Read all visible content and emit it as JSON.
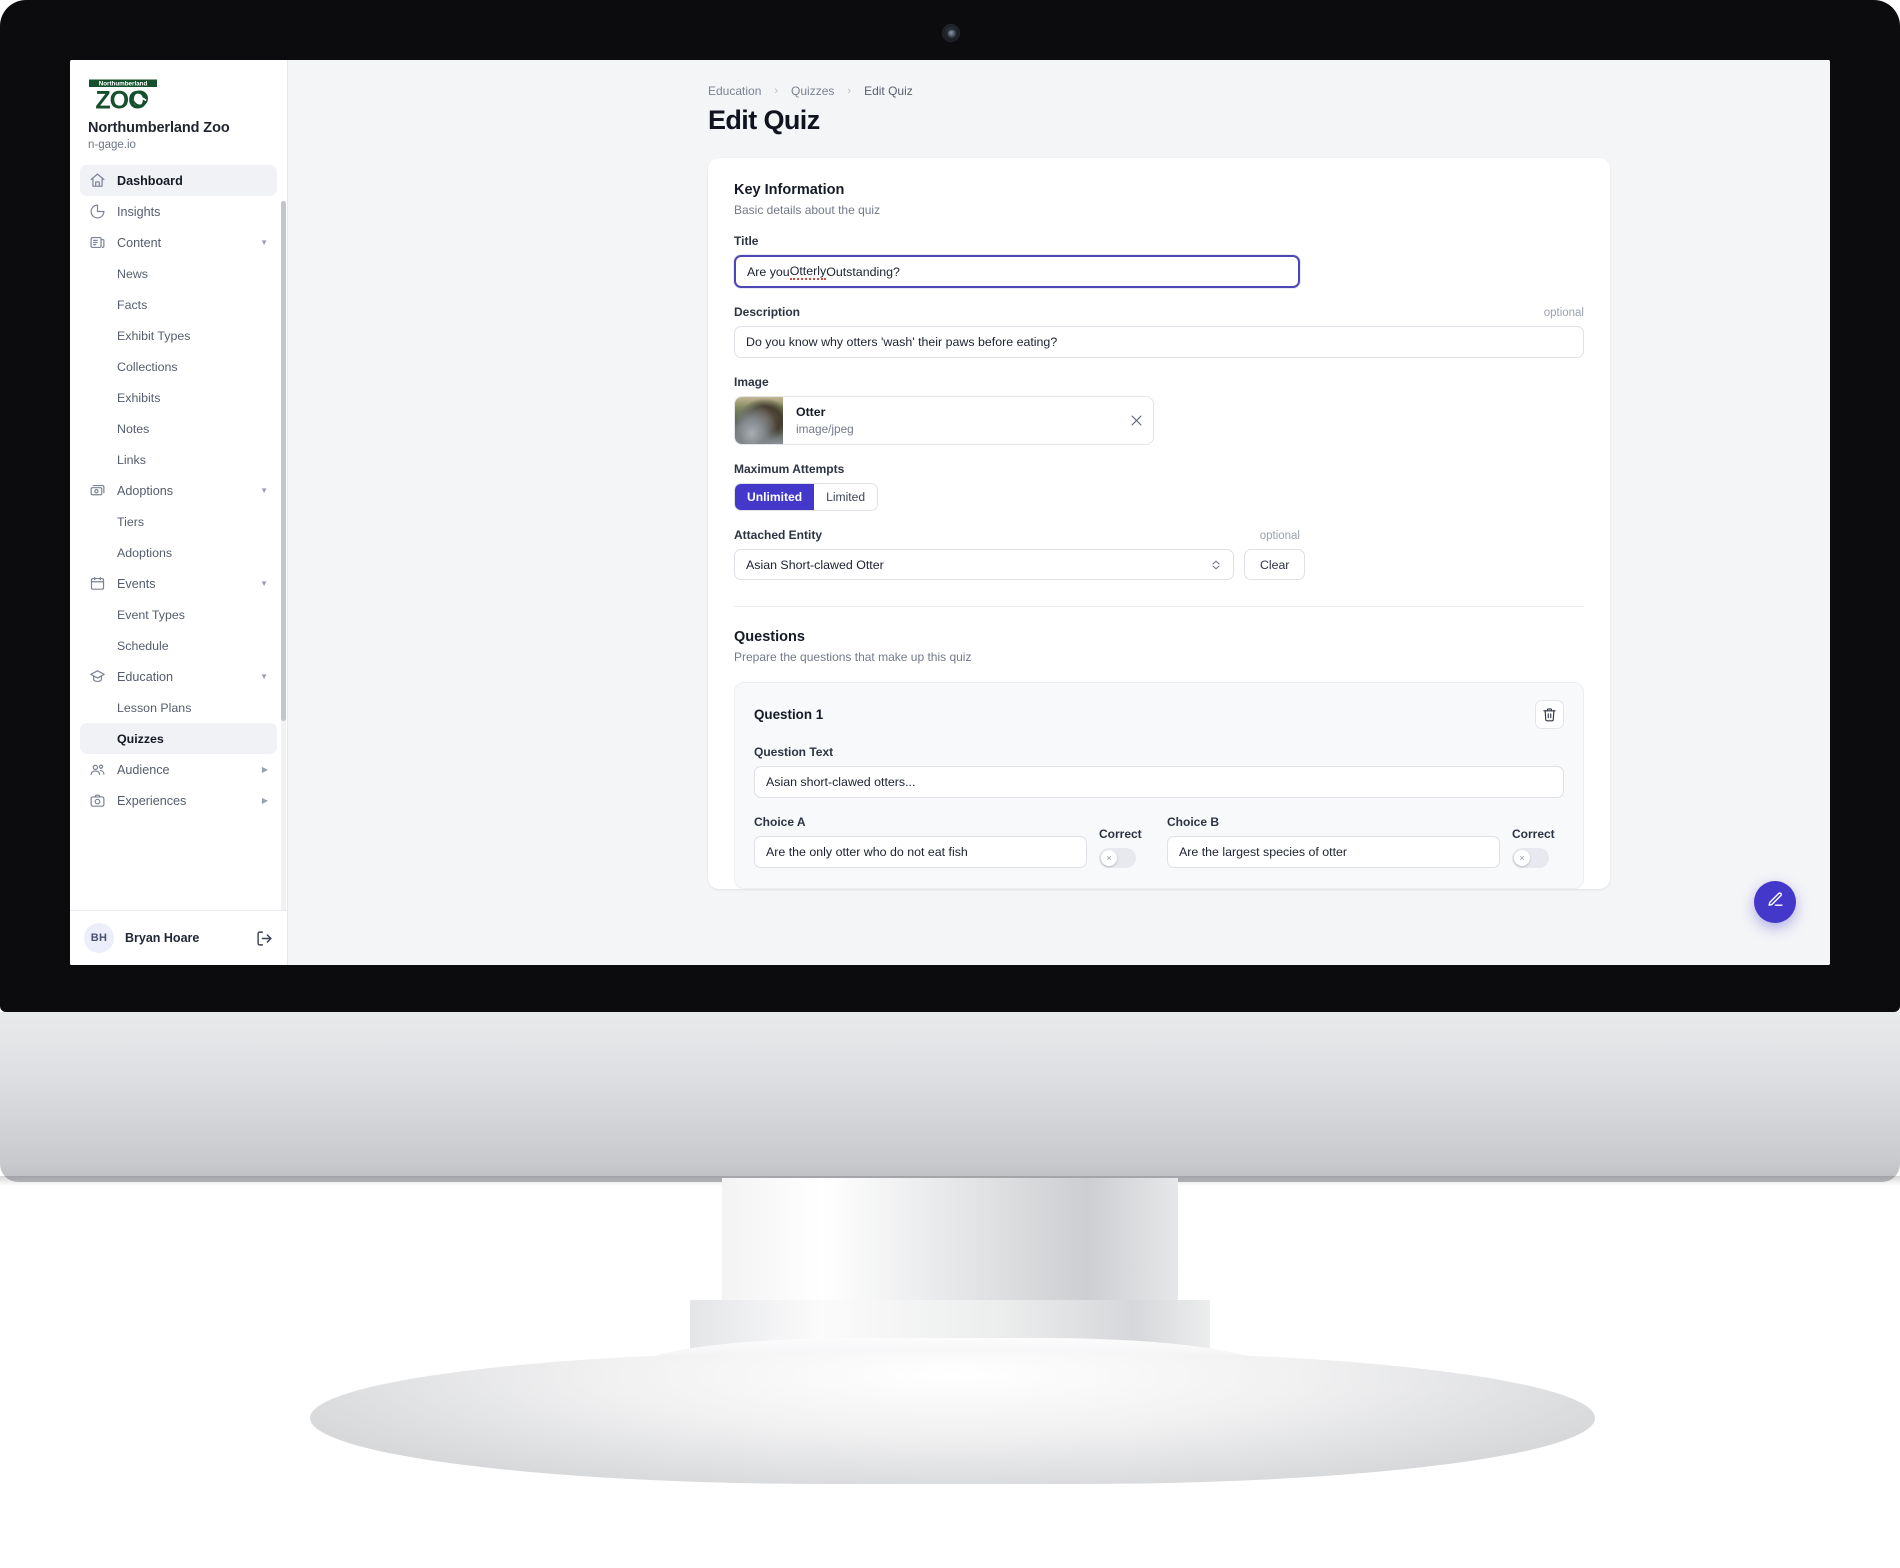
{
  "brand": {
    "logo_alt": "Northumberland Zoo logo",
    "logo_top_word": "Northumberland",
    "logo_main_word": "ZOO",
    "name": "Northumberland Zoo",
    "domain": "n-gage.io",
    "logo_color": "#14502c"
  },
  "sidebar": {
    "items": [
      {
        "label": "Dashboard",
        "icon": "home-icon",
        "level": "top",
        "active": true,
        "caret": ""
      },
      {
        "label": "Insights",
        "icon": "pie-chart-icon",
        "level": "top",
        "active": false,
        "caret": ""
      },
      {
        "label": "Content",
        "icon": "news-icon",
        "level": "top",
        "active": false,
        "caret": "down"
      },
      {
        "label": "News",
        "icon": "",
        "level": "sub",
        "active": false,
        "caret": ""
      },
      {
        "label": "Facts",
        "icon": "",
        "level": "sub",
        "active": false,
        "caret": ""
      },
      {
        "label": "Exhibit Types",
        "icon": "",
        "level": "sub",
        "active": false,
        "caret": ""
      },
      {
        "label": "Collections",
        "icon": "",
        "level": "sub",
        "active": false,
        "caret": ""
      },
      {
        "label": "Exhibits",
        "icon": "",
        "level": "sub",
        "active": false,
        "caret": ""
      },
      {
        "label": "Notes",
        "icon": "",
        "level": "sub",
        "active": false,
        "caret": ""
      },
      {
        "label": "Links",
        "icon": "",
        "level": "sub",
        "active": false,
        "caret": ""
      },
      {
        "label": "Adoptions",
        "icon": "money-icon",
        "level": "top",
        "active": false,
        "caret": "down"
      },
      {
        "label": "Tiers",
        "icon": "",
        "level": "sub",
        "active": false,
        "caret": ""
      },
      {
        "label": "Adoptions",
        "icon": "",
        "level": "sub",
        "active": false,
        "caret": ""
      },
      {
        "label": "Events",
        "icon": "calendar-icon",
        "level": "top",
        "active": false,
        "caret": "down"
      },
      {
        "label": "Event Types",
        "icon": "",
        "level": "sub",
        "active": false,
        "caret": ""
      },
      {
        "label": "Schedule",
        "icon": "",
        "level": "sub",
        "active": false,
        "caret": ""
      },
      {
        "label": "Education",
        "icon": "graduation-cap-icon",
        "level": "top",
        "active": false,
        "caret": "down"
      },
      {
        "label": "Lesson Plans",
        "icon": "",
        "level": "sub",
        "active": false,
        "caret": ""
      },
      {
        "label": "Quizzes",
        "icon": "",
        "level": "sub",
        "active": true,
        "caret": ""
      },
      {
        "label": "Audience",
        "icon": "users-icon",
        "level": "top",
        "active": false,
        "caret": "right"
      },
      {
        "label": "Experiences",
        "icon": "camera-icon",
        "level": "top",
        "active": false,
        "caret": "right"
      }
    ],
    "user": {
      "initials": "BH",
      "name": "Bryan Hoare",
      "logout_icon": "logout-icon"
    }
  },
  "header": {
    "breadcrumb": [
      "Education",
      "Quizzes",
      "Edit Quiz"
    ],
    "breadcrumb_separator": "›",
    "title": "Edit Quiz"
  },
  "key_information": {
    "section_title": "Key Information",
    "section_subtitle": "Basic details about the quiz",
    "title_label": "Title",
    "title_value": "Are you Otterly Outstanding?",
    "title_value_pre": "Are you ",
    "title_value_misspelled": "Otterly",
    "title_value_post": " Outstanding?",
    "description_label": "Description",
    "description_optional": "optional",
    "description_value": "Do you know why otters 'wash' their paws before eating?",
    "image_label": "Image",
    "image_name": "Otter",
    "image_type": "image/jpeg",
    "image_remove_icon": "close-icon",
    "max_attempts_label": "Maximum Attempts",
    "max_attempts_options": [
      "Unlimited",
      "Limited"
    ],
    "max_attempts_selected": "Unlimited",
    "attached_entity_label": "Attached Entity",
    "attached_entity_optional": "optional",
    "attached_entity_value": "Asian Short-clawed Otter",
    "clear_label": "Clear"
  },
  "questions": {
    "section_title": "Questions",
    "section_subtitle": "Prepare the questions that make up this quiz",
    "items": [
      {
        "heading": "Question 1",
        "delete_icon": "trash-icon",
        "question_text_label": "Question Text",
        "question_text_value": "Asian short-clawed otters...",
        "choice_a_label": "Choice A",
        "choice_a_value": "Are the only otter who do not eat fish",
        "choice_a_correct_label": "Correct",
        "choice_a_correct": false,
        "choice_b_label": "Choice B",
        "choice_b_value": "Are the largest species of otter",
        "choice_b_correct_label": "Correct",
        "choice_b_correct": false,
        "toggle_off_glyph": "×"
      }
    ]
  },
  "fab": {
    "icon": "pencil-icon",
    "color": "#4338ca"
  },
  "theme": {
    "accent": "#4338ca",
    "focus_ring": "#4f46b5",
    "page_bg": "#f4f5f7",
    "card_bg": "#ffffff",
    "text": "#141a26",
    "muted": "#737a88"
  }
}
